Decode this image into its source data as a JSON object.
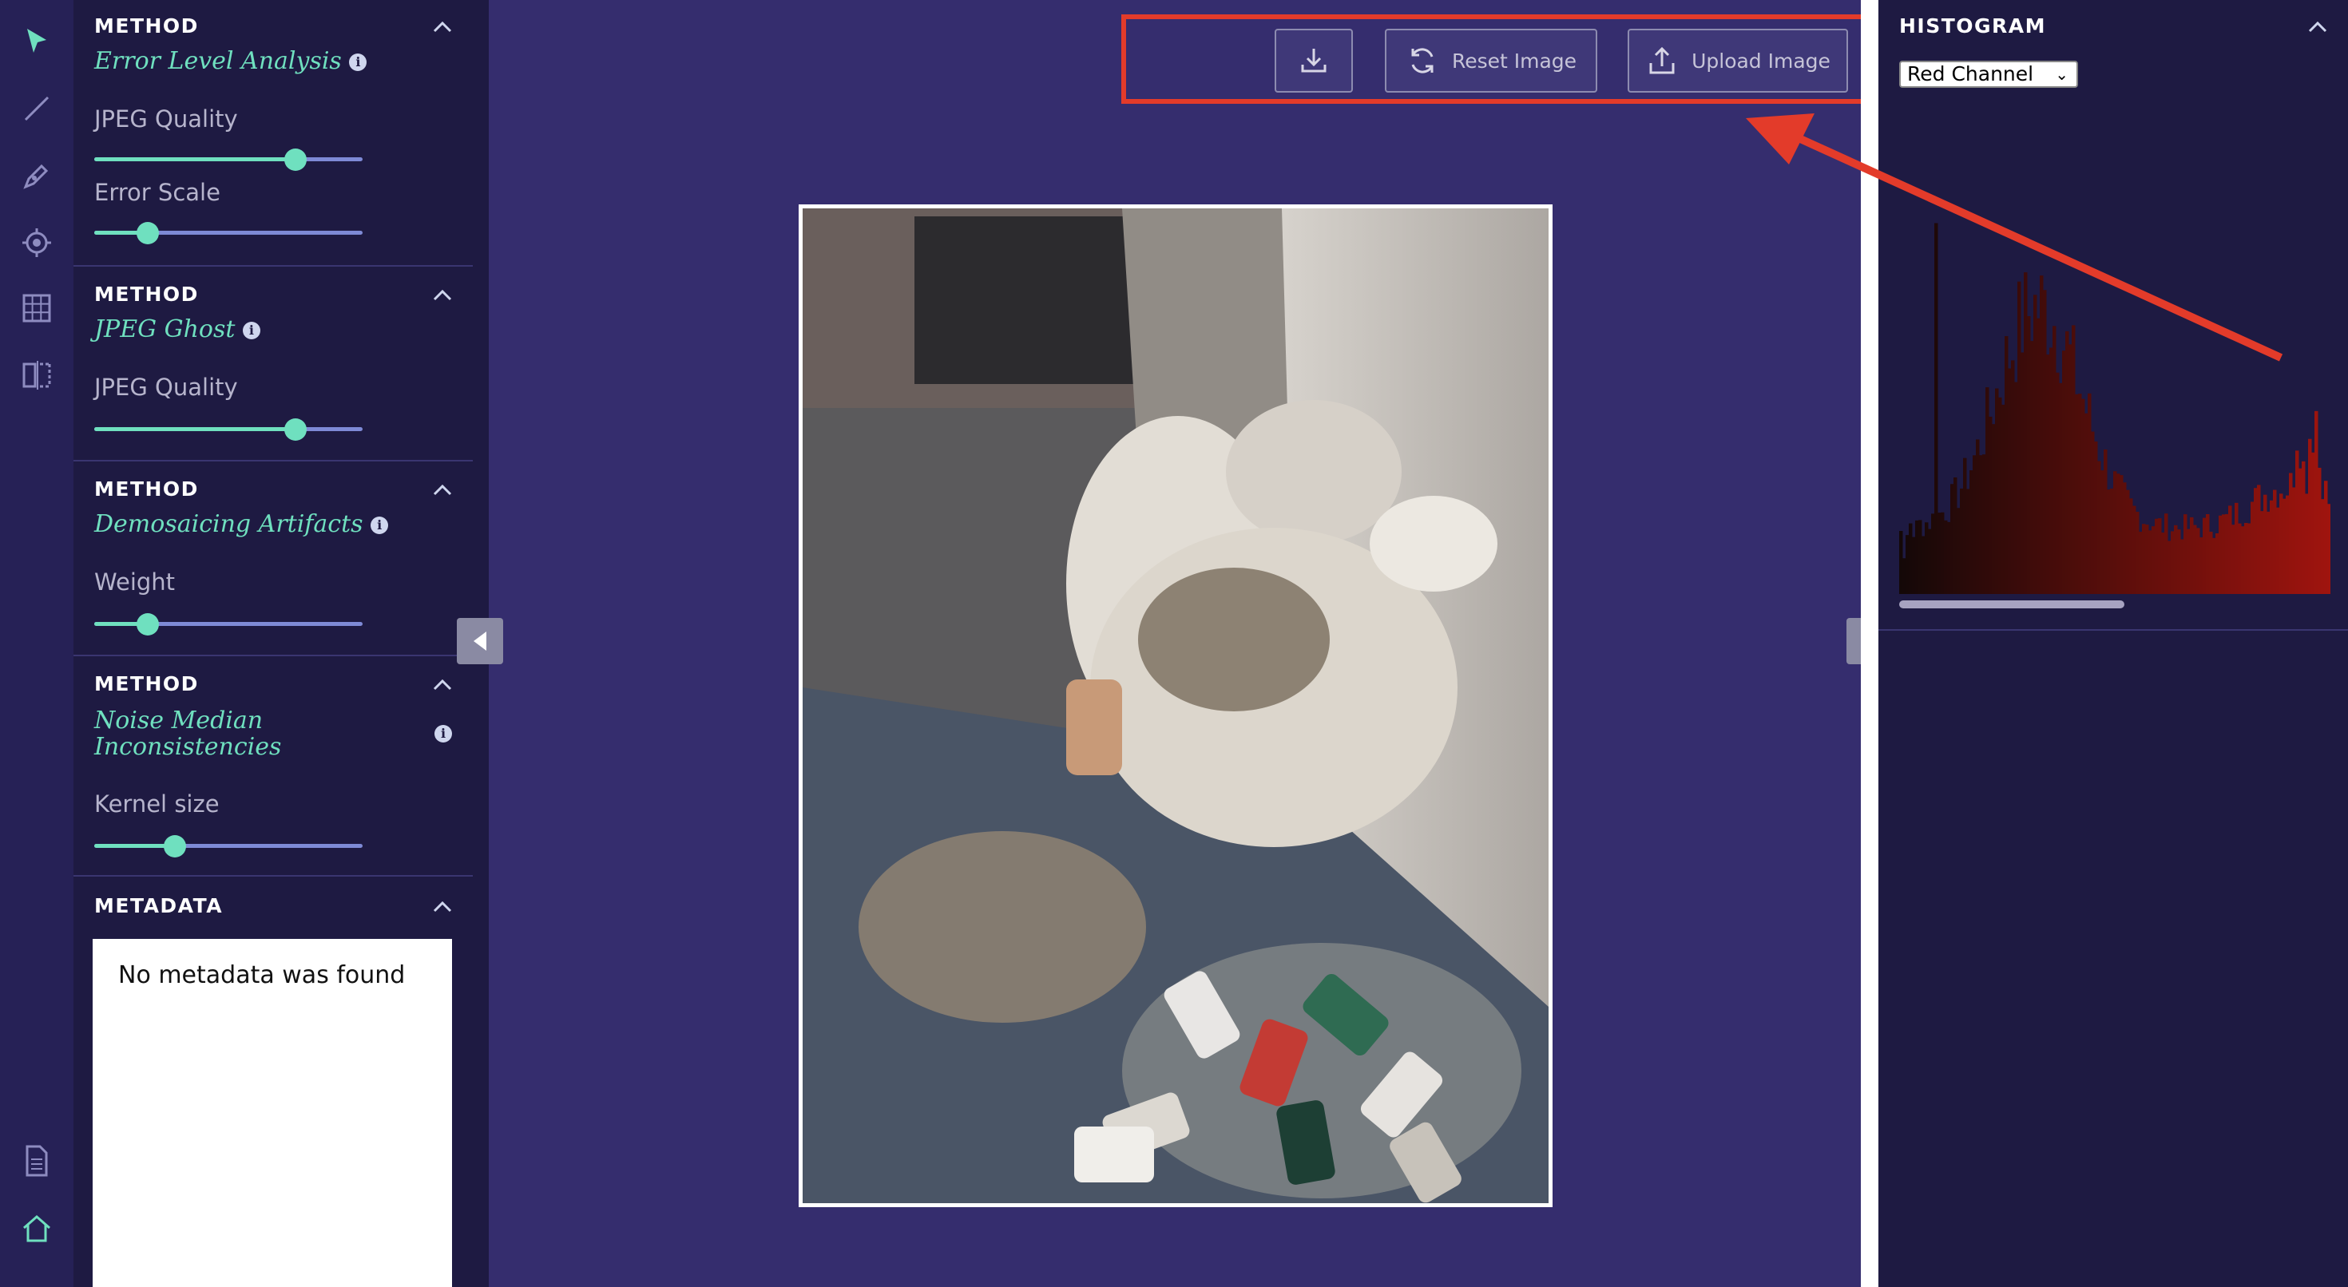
{
  "sidebar_tools": [
    {
      "name": "pointer-tool",
      "icon": "cursor-arrow-icon",
      "active": true
    },
    {
      "name": "line-tool",
      "icon": "line-icon"
    },
    {
      "name": "pen-tool",
      "icon": "pen-icon"
    },
    {
      "name": "target-tool",
      "icon": "crosshair-icon"
    },
    {
      "name": "grid-tool",
      "icon": "grid-icon"
    },
    {
      "name": "compare-tool",
      "icon": "split-view-icon"
    },
    {
      "name": "document-tool",
      "icon": "document-icon"
    },
    {
      "name": "home-tool",
      "icon": "home-icon"
    }
  ],
  "methods": {
    "ela": {
      "header": "METHOD",
      "name": "Error Level Analysis",
      "params": [
        {
          "label": "JPEG Quality",
          "value": 0.75
        },
        {
          "label": "Error Scale",
          "value": 0.2
        }
      ]
    },
    "ghost": {
      "header": "METHOD",
      "name": "JPEG Ghost",
      "params": [
        {
          "label": "JPEG Quality",
          "value": 0.75
        }
      ]
    },
    "demosaic": {
      "header": "METHOD",
      "name": "Demosaicing Artifacts",
      "params": [
        {
          "label": "Weight",
          "value": 0.2
        }
      ]
    },
    "noise": {
      "header": "METHOD",
      "name_line1": "Noise Median",
      "name_line2": "Inconsistencies",
      "params": [
        {
          "label": "Kernel size",
          "value": 0.3
        }
      ]
    }
  },
  "metadata": {
    "header": "METADATA",
    "text": "No metadata was found"
  },
  "toolbar": {
    "download_icon": "download-icon",
    "reset_label": "Reset Image",
    "upload_label": "Upload Image"
  },
  "info_glyph": "i",
  "histogram": {
    "header": "HISTOGRAM",
    "channel": "Red Channel",
    "channel_options": [
      "Red Channel"
    ],
    "color": "#8b1a0e"
  },
  "colors": {
    "accent": "#6fe0bf",
    "highlight": "#e33b2a",
    "main_bg": "#352d6e",
    "panel_bg": "#1e1a42"
  }
}
